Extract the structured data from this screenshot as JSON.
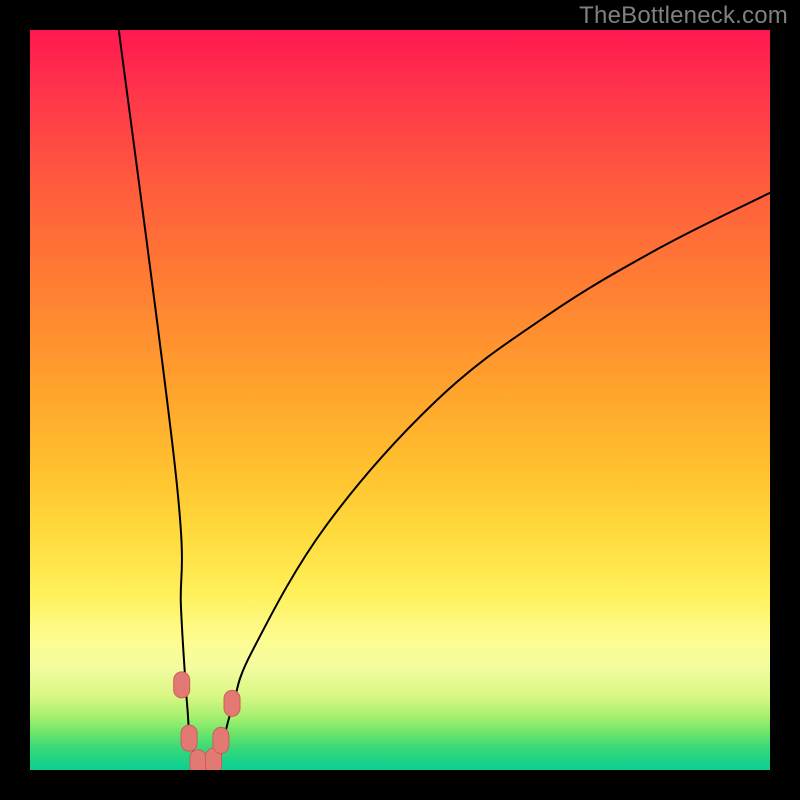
{
  "watermark": "TheBottleneck.com",
  "chart_data": {
    "type": "line",
    "title": "",
    "xlabel": "",
    "ylabel": "",
    "x_range": [
      0,
      100
    ],
    "y_range": [
      0,
      100
    ],
    "curve_description": "V-shaped bottleneck curve: steep descent from top-left to a minimum near x≈23 (y≈0), then rising concave to top-right around y≈78",
    "series": [
      {
        "name": "bottleneck-curve",
        "points_xy": [
          [
            12.0,
            100.0
          ],
          [
            19.7,
            40.0
          ],
          [
            20.4,
            22.0
          ],
          [
            21.0,
            12.0
          ],
          [
            21.3,
            8.0
          ],
          [
            21.6,
            4.5
          ],
          [
            22.5,
            1.0
          ],
          [
            23.0,
            0.5
          ],
          [
            24.0,
            0.5
          ],
          [
            25.5,
            1.5
          ],
          [
            26.0,
            3.0
          ],
          [
            26.5,
            5.5
          ],
          [
            27.5,
            9.0
          ],
          [
            30.0,
            16.0
          ],
          [
            40.0,
            33.0
          ],
          [
            55.0,
            50.0
          ],
          [
            70.0,
            61.5
          ],
          [
            85.0,
            70.5
          ],
          [
            100.0,
            78.0
          ]
        ]
      }
    ],
    "markers": [
      {
        "x": 20.5,
        "y": 11.5
      },
      {
        "x": 21.5,
        "y": 4.3
      },
      {
        "x": 22.7,
        "y": 1.0
      },
      {
        "x": 24.8,
        "y": 1.2
      },
      {
        "x": 25.8,
        "y": 4.0
      },
      {
        "x": 27.3,
        "y": 9.0
      }
    ],
    "gradient_description": "Vertical gradient: red (top, high bottleneck) → orange → yellow → green (bottom, no bottleneck)",
    "colors": {
      "curve": "#000000",
      "marker_fill": "#e27a73",
      "marker_stroke": "#c85f58",
      "background_frame": "#000000",
      "watermark": "#808080"
    }
  }
}
